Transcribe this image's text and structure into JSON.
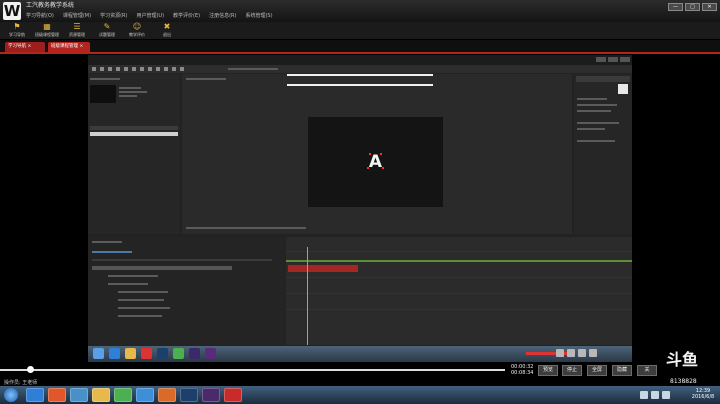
{
  "app": {
    "logo": "W",
    "title": "工汽教务教学系统",
    "menu": [
      "学习导航(O)",
      "课程管理(M)",
      "学习资源(R)",
      "用户管理(U)",
      "教学评价(E)",
      "注册信息(R)",
      "系统管理(S)"
    ],
    "window_controls": [
      "—",
      "□",
      "✕"
    ]
  },
  "toolbar": {
    "items": [
      {
        "label": "学习导航",
        "glyph": "⚑",
        "icon": "flag-icon"
      },
      {
        "label": "班级课程管理",
        "glyph": "▦",
        "icon": "grid-icon"
      },
      {
        "label": "资源管理",
        "glyph": "☰",
        "icon": "list-icon"
      },
      {
        "label": "试题管理",
        "glyph": "✎",
        "icon": "edit-icon"
      },
      {
        "label": "教学评价",
        "glyph": "☺",
        "icon": "face-icon"
      },
      {
        "label": "退出",
        "glyph": "✖",
        "icon": "exit-icon"
      }
    ]
  },
  "tabs": [
    {
      "label": "学习导航",
      "close": "×"
    },
    {
      "label": "班级课程管理",
      "close": "×"
    }
  ],
  "ae": {
    "comp_glyph": "A"
  },
  "player": {
    "progress": 0.06,
    "time_current": "00:00:32",
    "time_total": "00:08:34",
    "buttons": [
      "预览",
      "停止",
      "全屏",
      "隐藏",
      "关"
    ]
  },
  "status": {
    "operator": "操作员: 王老师"
  },
  "watermark": {
    "brand": "斗鱼",
    "room": "8138828"
  },
  "taskbar": {
    "clock_time": "12:39",
    "clock_date": "2016/6/8",
    "apps": [
      {
        "name": "ie-icon",
        "color": "#2f7fd6"
      },
      {
        "name": "media-player-icon",
        "color": "#e0572b"
      },
      {
        "name": "explorer-icon",
        "color": "#4a90c8"
      },
      {
        "name": "folder-icon",
        "color": "#e7b84c"
      },
      {
        "name": "chrome-icon",
        "color": "#4caf50"
      },
      {
        "name": "browser-icon",
        "color": "#3f8fd8"
      },
      {
        "name": "app-icon",
        "color": "#d96a2a"
      },
      {
        "name": "photoshop-icon",
        "color": "#1d3f6b"
      },
      {
        "name": "premiere-icon",
        "color": "#4a2a6b"
      },
      {
        "name": "recorder-icon",
        "color": "#c72b2b"
      }
    ]
  },
  "ae_taskbar": {
    "apps": [
      {
        "name": "start-icon",
        "color": "#5aa0e8"
      },
      {
        "name": "ie-icon",
        "color": "#2f7fd6"
      },
      {
        "name": "folder-icon",
        "color": "#e7b84c"
      },
      {
        "name": "media-icon",
        "color": "#d33"
      },
      {
        "name": "photoshop-icon",
        "color": "#1d3f6b"
      },
      {
        "name": "chrome-icon",
        "color": "#4caf50"
      },
      {
        "name": "after-effects-icon",
        "color": "#3a2a6b"
      },
      {
        "name": "premiere-icon",
        "color": "#5a2a7b"
      }
    ]
  },
  "colors": {
    "accent_red": "#b3241f",
    "toolbar_icon": "#e6b93c"
  }
}
